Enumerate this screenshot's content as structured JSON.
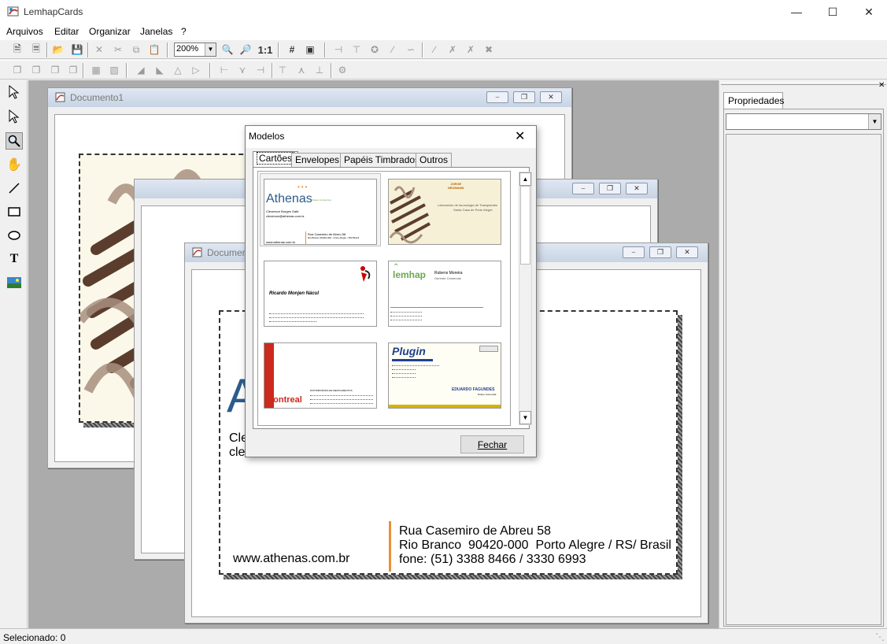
{
  "app": {
    "title": "LemhapCards"
  },
  "menu": [
    "Arquivos",
    "Editar",
    "Organizar",
    "Janelas",
    "?"
  ],
  "toolbar": {
    "zoom": "200%",
    "one_to_one": "1:1"
  },
  "windows": {
    "doc1_title": "Documento1",
    "doc2_title": "Documento2"
  },
  "card_main": {
    "name_line1": "Cle",
    "name_line2": "clev",
    "big_letter": "A",
    "website": "www.athenas.com.br",
    "address1": "Rua Casemiro de Abreu 58",
    "address2": "Rio Branco  90420-000  Porto Alegre / RS/ Brasil",
    "phone": "fone: (51) 3388 8466 / 3330 6993"
  },
  "properties": {
    "tab_label": "Propriedades"
  },
  "status": {
    "selected": "Selecionado: 0"
  },
  "dialog": {
    "title": "Modelos",
    "tabs": [
      "Cartões",
      "Envelopes",
      "Papéis Timbrados",
      "Outros"
    ],
    "close_button": "Fechar",
    "templates": [
      {
        "id": "athenas",
        "brand": "Athenas",
        "tagline": "software & sistemas",
        "person": "Cleverson Borges Gatti",
        "email": "cleverson@athenas.com.br",
        "site": "www.athenas.com.br",
        "address": "Rua Casemiro de Abreu 58",
        "city": "Rio Branco 90420-000 - Porto Alegre / RS/ Brasil"
      },
      {
        "id": "jorge",
        "person": "JORGE\nNEUMANN",
        "role": "Laboratório de Imunologia de Transplantes",
        "org": "Santa Casa de Porto Alegre"
      },
      {
        "id": "ricardo",
        "person": "Ricardo Monjen Nácul"
      },
      {
        "id": "lemhap",
        "brand": "lemhap",
        "person": "Rubens Moreira",
        "role": "Gerente Comercial"
      },
      {
        "id": "montreal",
        "brand": "Montreal",
        "role": "DISTRIBUIDORA DE MEDICAMENTOS"
      },
      {
        "id": "plugin",
        "brand": "Plugin",
        "person": "EDUARDO FAGUNDES",
        "role": "Diretor Comercial"
      }
    ]
  },
  "colors": {
    "accent_green": "#6aa84f",
    "accent_orange": "#e69138",
    "brand_blue": "#2c5c8a",
    "plugin_blue": "#1f3f8f"
  }
}
